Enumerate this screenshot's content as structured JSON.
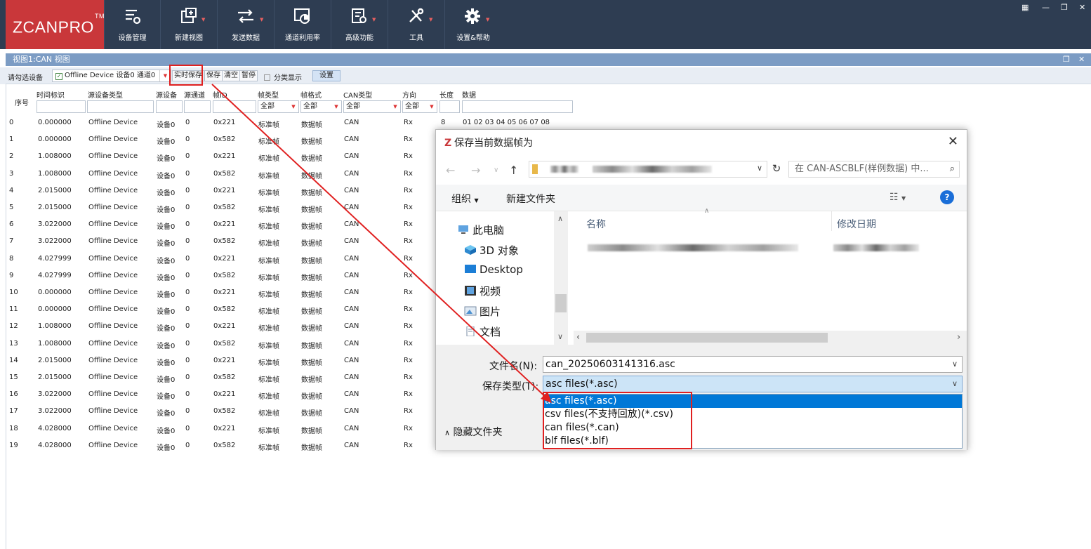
{
  "app": {
    "logo": "ZCANPRO",
    "logo_tm": "TM",
    "toolbar": [
      {
        "label": "设备管理",
        "icon": "device-manage-icon",
        "dropdown": false
      },
      {
        "label": "新建视图",
        "icon": "new-view-icon",
        "dropdown": true
      },
      {
        "label": "发送数据",
        "icon": "send-data-icon",
        "dropdown": true
      },
      {
        "label": "通道利用率",
        "icon": "channel-usage-icon",
        "dropdown": false
      },
      {
        "label": "高级功能",
        "icon": "advanced-icon",
        "dropdown": true
      },
      {
        "label": "工具",
        "icon": "tools-icon",
        "dropdown": true
      },
      {
        "label": "设置&帮助",
        "icon": "gear-icon",
        "dropdown": true
      }
    ],
    "window_controls": [
      "grid-icon",
      "minimize-icon",
      "restore-icon",
      "close-icon"
    ]
  },
  "view": {
    "title": "视图1:CAN 视图",
    "device_label": "请勾选设备",
    "device_value": "Offline Device 设备0 通道0",
    "buttons": {
      "realtime_save": "实时保存",
      "save": "保存",
      "clear": "清空",
      "pause": "暂停"
    },
    "classify_label": "分类显示",
    "settings_button": "设置",
    "columns": {
      "seq": "序号",
      "time": "时间标识",
      "src_type": "源设备类型",
      "src_dev": "源设备",
      "src_ch": "源通道",
      "frame_id": "帧ID",
      "frame_type": "帧类型",
      "frame_fmt": "帧格式",
      "can_type": "CAN类型",
      "direction": "方向",
      "length": "长度",
      "data": "数据"
    },
    "filters": {
      "all": "全部"
    },
    "rows": [
      {
        "seq": "0",
        "time": "0.000000",
        "src": "Offline Device",
        "dev": "设备0",
        "ch": "0",
        "id": "0x221",
        "ftype": "标准帧",
        "ffmt": "数据帧",
        "can": "CAN",
        "dir": "Rx",
        "len": "8",
        "data": "01 02 03 04 05 06 07 08"
      },
      {
        "seq": "1",
        "time": "0.000000",
        "src": "Offline Device",
        "dev": "设备0",
        "ch": "0",
        "id": "0x582",
        "ftype": "标准帧",
        "ffmt": "数据帧",
        "can": "CAN",
        "dir": "Rx",
        "len": "",
        "data": ""
      },
      {
        "seq": "2",
        "time": "1.008000",
        "src": "Offline Device",
        "dev": "设备0",
        "ch": "0",
        "id": "0x221",
        "ftype": "标准帧",
        "ffmt": "数据帧",
        "can": "CAN",
        "dir": "Rx",
        "len": "",
        "data": ""
      },
      {
        "seq": "3",
        "time": "1.008000",
        "src": "Offline Device",
        "dev": "设备0",
        "ch": "0",
        "id": "0x582",
        "ftype": "标准帧",
        "ffmt": "数据帧",
        "can": "CAN",
        "dir": "Rx",
        "len": "",
        "data": ""
      },
      {
        "seq": "4",
        "time": "2.015000",
        "src": "Offline Device",
        "dev": "设备0",
        "ch": "0",
        "id": "0x221",
        "ftype": "标准帧",
        "ffmt": "数据帧",
        "can": "CAN",
        "dir": "Rx",
        "len": "",
        "data": ""
      },
      {
        "seq": "5",
        "time": "2.015000",
        "src": "Offline Device",
        "dev": "设备0",
        "ch": "0",
        "id": "0x582",
        "ftype": "标准帧",
        "ffmt": "数据帧",
        "can": "CAN",
        "dir": "Rx",
        "len": "",
        "data": ""
      },
      {
        "seq": "6",
        "time": "3.022000",
        "src": "Offline Device",
        "dev": "设备0",
        "ch": "0",
        "id": "0x221",
        "ftype": "标准帧",
        "ffmt": "数据帧",
        "can": "CAN",
        "dir": "Rx",
        "len": "",
        "data": ""
      },
      {
        "seq": "7",
        "time": "3.022000",
        "src": "Offline Device",
        "dev": "设备0",
        "ch": "0",
        "id": "0x582",
        "ftype": "标准帧",
        "ffmt": "数据帧",
        "can": "CAN",
        "dir": "Rx",
        "len": "",
        "data": ""
      },
      {
        "seq": "8",
        "time": "4.027999",
        "src": "Offline Device",
        "dev": "设备0",
        "ch": "0",
        "id": "0x221",
        "ftype": "标准帧",
        "ffmt": "数据帧",
        "can": "CAN",
        "dir": "Rx",
        "len": "",
        "data": ""
      },
      {
        "seq": "9",
        "time": "4.027999",
        "src": "Offline Device",
        "dev": "设备0",
        "ch": "0",
        "id": "0x582",
        "ftype": "标准帧",
        "ffmt": "数据帧",
        "can": "CAN",
        "dir": "Rx",
        "len": "",
        "data": ""
      },
      {
        "seq": "10",
        "time": "0.000000",
        "src": "Offline Device",
        "dev": "设备0",
        "ch": "0",
        "id": "0x221",
        "ftype": "标准帧",
        "ffmt": "数据帧",
        "can": "CAN",
        "dir": "Rx",
        "len": "",
        "data": ""
      },
      {
        "seq": "11",
        "time": "0.000000",
        "src": "Offline Device",
        "dev": "设备0",
        "ch": "0",
        "id": "0x582",
        "ftype": "标准帧",
        "ffmt": "数据帧",
        "can": "CAN",
        "dir": "Rx",
        "len": "",
        "data": ""
      },
      {
        "seq": "12",
        "time": "1.008000",
        "src": "Offline Device",
        "dev": "设备0",
        "ch": "0",
        "id": "0x221",
        "ftype": "标准帧",
        "ffmt": "数据帧",
        "can": "CAN",
        "dir": "Rx",
        "len": "",
        "data": ""
      },
      {
        "seq": "13",
        "time": "1.008000",
        "src": "Offline Device",
        "dev": "设备0",
        "ch": "0",
        "id": "0x582",
        "ftype": "标准帧",
        "ffmt": "数据帧",
        "can": "CAN",
        "dir": "Rx",
        "len": "",
        "data": ""
      },
      {
        "seq": "14",
        "time": "2.015000",
        "src": "Offline Device",
        "dev": "设备0",
        "ch": "0",
        "id": "0x221",
        "ftype": "标准帧",
        "ffmt": "数据帧",
        "can": "CAN",
        "dir": "Rx",
        "len": "",
        "data": ""
      },
      {
        "seq": "15",
        "time": "2.015000",
        "src": "Offline Device",
        "dev": "设备0",
        "ch": "0",
        "id": "0x582",
        "ftype": "标准帧",
        "ffmt": "数据帧",
        "can": "CAN",
        "dir": "Rx",
        "len": "",
        "data": ""
      },
      {
        "seq": "16",
        "time": "3.022000",
        "src": "Offline Device",
        "dev": "设备0",
        "ch": "0",
        "id": "0x221",
        "ftype": "标准帧",
        "ffmt": "数据帧",
        "can": "CAN",
        "dir": "Rx",
        "len": "",
        "data": ""
      },
      {
        "seq": "17",
        "time": "3.022000",
        "src": "Offline Device",
        "dev": "设备0",
        "ch": "0",
        "id": "0x582",
        "ftype": "标准帧",
        "ffmt": "数据帧",
        "can": "CAN",
        "dir": "Rx",
        "len": "",
        "data": ""
      },
      {
        "seq": "18",
        "time": "4.028000",
        "src": "Offline Device",
        "dev": "设备0",
        "ch": "0",
        "id": "0x221",
        "ftype": "标准帧",
        "ffmt": "数据帧",
        "can": "CAN",
        "dir": "Rx",
        "len": "",
        "data": ""
      },
      {
        "seq": "19",
        "time": "4.028000",
        "src": "Offline Device",
        "dev": "设备0",
        "ch": "0",
        "id": "0x582",
        "ftype": "标准帧",
        "ffmt": "数据帧",
        "can": "CAN",
        "dir": "Rx",
        "len": "",
        "data": ""
      }
    ]
  },
  "dialog": {
    "title": "保存当前数据帧为",
    "search_placeholder": "在 CAN-ASCBLF(样例数据) 中...",
    "organize": "组织",
    "new_folder": "新建文件夹",
    "tree": [
      {
        "label": "此电脑",
        "icon": "computer-icon"
      },
      {
        "label": "3D 对象",
        "icon": "3d-objects-icon"
      },
      {
        "label": "Desktop",
        "icon": "desktop-icon"
      },
      {
        "label": "视频",
        "icon": "video-icon"
      },
      {
        "label": "图片",
        "icon": "pictures-icon"
      },
      {
        "label": "文档",
        "icon": "documents-icon"
      }
    ],
    "col_name": "名称",
    "col_modified": "修改日期",
    "filename_label": "文件名(N):",
    "filename_value": "can_20250603141316.asc",
    "filetype_label": "保存类型(T):",
    "filetype_value": "asc files(*.asc)",
    "filetype_options": [
      "asc files(*.asc)",
      "csv files(不支持回放)(*.csv)",
      "can files(*.can)",
      "blf files(*.blf)"
    ],
    "hide_folders": "隐藏文件夹"
  },
  "colors": {
    "topbar": "#2e3d52",
    "logo_bg": "#c9373a",
    "viewbar": "#7c9cc4",
    "highlight": "#e02020",
    "selected_option": "#0078d7"
  }
}
